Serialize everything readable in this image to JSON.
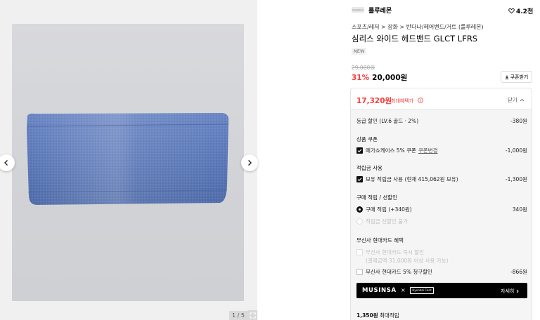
{
  "gallery": {
    "counter": "1 / 5"
  },
  "brand": {
    "name": "룰루레몬",
    "likes": "4.2천"
  },
  "product": {
    "breadcrumb": "스포츠/레저 > 잡화 > 반다나/헤어밴드/거트 (룰루레몬)",
    "title": "심리스 와이드 헤드밴드 GLCT LFRS",
    "badge": "NEW",
    "original_price": "29,000원",
    "discount": "31%",
    "price": "20,000원",
    "coupon_button": "쿠폰받기"
  },
  "benefits": {
    "max_price": "17,320원",
    "max_label": "최대혜택가",
    "close_label": "닫기",
    "grade_discount": {
      "label": "등급 할인 (LV.6 골드 · 2%)",
      "amount": "-380원"
    },
    "coupon_section": "상품 쿠폰",
    "coupon_item": {
      "label": "메가쇼케이스 5% 쿠폰",
      "link": "쿠폰변경",
      "amount": "-1,000원"
    },
    "points_section": "적립금 사용",
    "points_item": {
      "label": "보유 적립금 사용 (현재 415,062원 보유)",
      "amount": "-1,300원"
    },
    "earn_section": "구매 적립 / 선할인",
    "earn_item": {
      "label": "구매 적립 (+340원)",
      "amount": "340원"
    },
    "preearn_item": {
      "label": "적립금 선할인 불가"
    },
    "card_section": "무신사 현대카드 혜택",
    "card_instant": {
      "line1": "무신사 현대카드 즉시 할인",
      "line2": "(결제금액 31,000원 이상 사용 가능)"
    },
    "card_claim": {
      "label": "무신사 현대카드 5% 청구할인",
      "amount": "-866원"
    },
    "banner": {
      "logo": "MUSINSA",
      "x": "×",
      "card": "Hyundai Card",
      "detail": "자세히"
    },
    "total_points": {
      "amount": "1,350원",
      "label": "최대적립"
    }
  },
  "colors": {
    "accent_red": "#ff3b3b",
    "headband_blue": "#5b78b8"
  }
}
